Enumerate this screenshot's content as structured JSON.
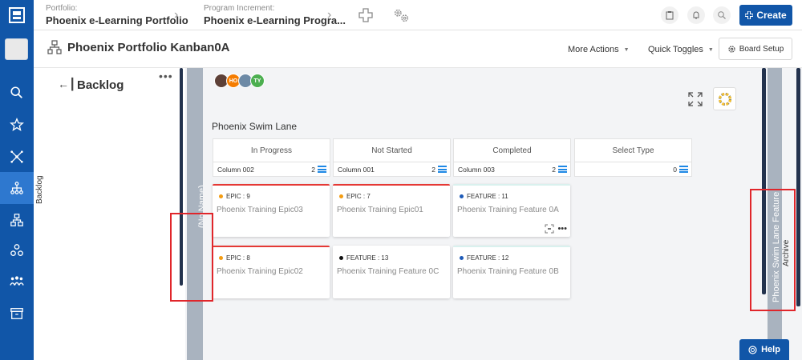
{
  "nav": {
    "items": [
      {
        "name": "search",
        "icon": "search-icon"
      },
      {
        "name": "favorites",
        "icon": "star-icon"
      },
      {
        "name": "connections",
        "icon": "network-icon"
      },
      {
        "name": "hierarchy",
        "icon": "hierarchy-icon",
        "active": true
      },
      {
        "name": "portfolio",
        "icon": "org-chart-icon"
      },
      {
        "name": "groups",
        "icon": "cluster-icon"
      },
      {
        "name": "teams",
        "icon": "team-icon"
      },
      {
        "name": "archive",
        "icon": "archive-icon"
      }
    ]
  },
  "topbar": {
    "portfolio_label": "Portfolio:",
    "portfolio_value": "Phoenix e-Learning Portfolio",
    "pi_label": "Program Increment:",
    "pi_value": "Phoenix e-Learning Progra...",
    "create_label": "Create"
  },
  "subheader": {
    "title": "Phoenix Portfolio Kanban0A",
    "more_actions": "More Actions",
    "quick_toggles": "Quick Toggles",
    "board_setup": "Board Setup"
  },
  "backlog": {
    "title": "Backlog",
    "vertical_label": "Backlog",
    "more": "•••"
  },
  "lane": {
    "no_name_label": "(No Name)",
    "swimlane_title": "Phoenix Swim Lane",
    "avatars": [
      {
        "initials": "",
        "color": "#5d4037"
      },
      {
        "initials": "HO",
        "color": "#f57c00"
      },
      {
        "initials": "",
        "color": "#6d8aa6"
      },
      {
        "initials": "TY",
        "color": "#4caf50"
      }
    ]
  },
  "columns": [
    {
      "header": "In Progress",
      "sub": "Column 002",
      "count": "2"
    },
    {
      "header": "Not Started",
      "sub": "Column 001",
      "count": "2"
    },
    {
      "header": "Completed",
      "sub": "Column 003",
      "count": "2"
    },
    {
      "header": "Select Type",
      "sub": "",
      "count": "0"
    }
  ],
  "cards": [
    {
      "type": "EPIC : 9",
      "title": "Phoenix Training Epic03",
      "dot": "#f39c12",
      "accent": "#e53935"
    },
    {
      "type": "EPIC : 7",
      "title": "Phoenix Training Epic01",
      "dot": "#f39c12",
      "accent": "#e53935"
    },
    {
      "type": "FEATURE : 11",
      "title": "Phoenix Training Feature 0A",
      "dot": "#1e5bb8",
      "accent": "#d9f1ee"
    },
    {
      "type": "EPIC : 8",
      "title": "Phoenix Training Epic02",
      "dot": "#f39c12",
      "accent": "#e53935"
    },
    {
      "type": "FEATURE : 13",
      "title": "Phoenix Training Feature 0C",
      "dot": "#111111",
      "accent": "#ffffff"
    },
    {
      "type": "FEATURE : 12",
      "title": "Phoenix Training Feature 0B",
      "dot": "#1e5bb8",
      "accent": "#d9f1ee"
    }
  ],
  "right_panel": {
    "label": "Phoenix Swim Lane Feature",
    "label2": "Archive"
  },
  "help": {
    "label": "Help"
  },
  "colors": {
    "brand": "#1156a8",
    "active_nav": "#2e78cf",
    "highlight": "#e0262b"
  }
}
